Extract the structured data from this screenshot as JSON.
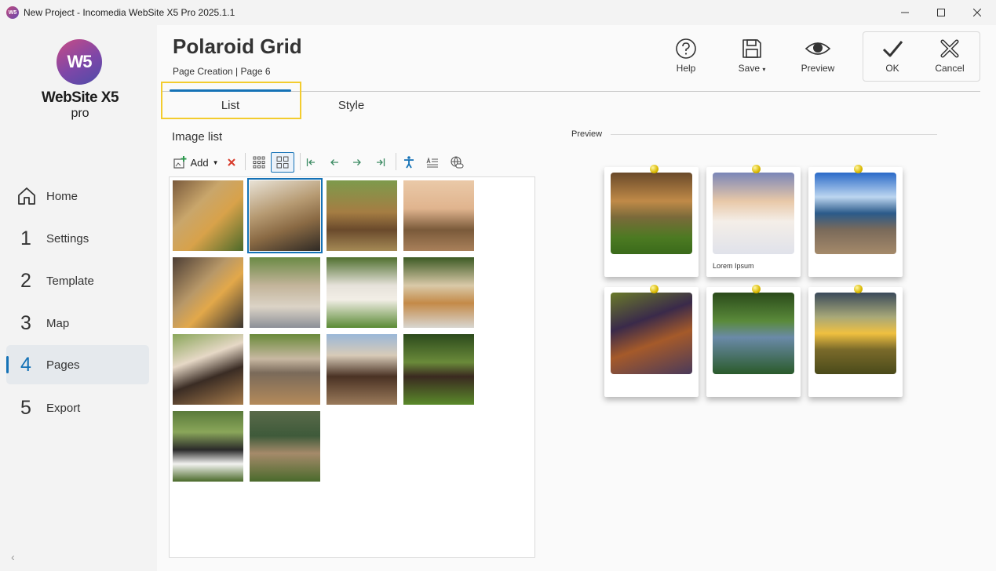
{
  "window": {
    "title": "New Project - Incomedia WebSite X5 Pro 2025.1.1",
    "icon_text": "W5"
  },
  "logo": {
    "mark": "W5",
    "name": "WebSite X5",
    "edition": "pro"
  },
  "sidebar": {
    "items": [
      {
        "num": "",
        "label": "Home",
        "icon": "home-icon"
      },
      {
        "num": "1",
        "label": "Settings"
      },
      {
        "num": "2",
        "label": "Template"
      },
      {
        "num": "3",
        "label": "Map"
      },
      {
        "num": "4",
        "label": "Pages",
        "active": true
      },
      {
        "num": "5",
        "label": "Export"
      }
    ],
    "collapse": "‹"
  },
  "header": {
    "title": "Polaroid Grid",
    "breadcrumb": "Page Creation | Page 6",
    "buttons": {
      "help": "Help",
      "save": "Save",
      "preview": "Preview",
      "ok": "OK",
      "cancel": "Cancel"
    }
  },
  "tabs": {
    "list": "List",
    "style": "Style"
  },
  "image_list": {
    "label": "Image list",
    "toolbar": {
      "add": "Add"
    },
    "thumbnails": [
      "thumb-1",
      "thumb-2",
      "thumb-3",
      "thumb-4",
      "thumb-5",
      "thumb-6",
      "thumb-7",
      "thumb-8",
      "thumb-9",
      "thumb-10",
      "thumb-11",
      "thumb-12",
      "thumb-13",
      "thumb-14"
    ],
    "selected_index": 1
  },
  "preview": {
    "label": "Preview",
    "cards": [
      {
        "caption": ""
      },
      {
        "caption": "Lorem Ipsum"
      },
      {
        "caption": ""
      },
      {
        "caption": ""
      },
      {
        "caption": ""
      },
      {
        "caption": ""
      }
    ]
  },
  "colors": {
    "accent": "#1572b6",
    "highlight": "#f3cc2e",
    "sidebar_bg": "#f3f3f3"
  }
}
